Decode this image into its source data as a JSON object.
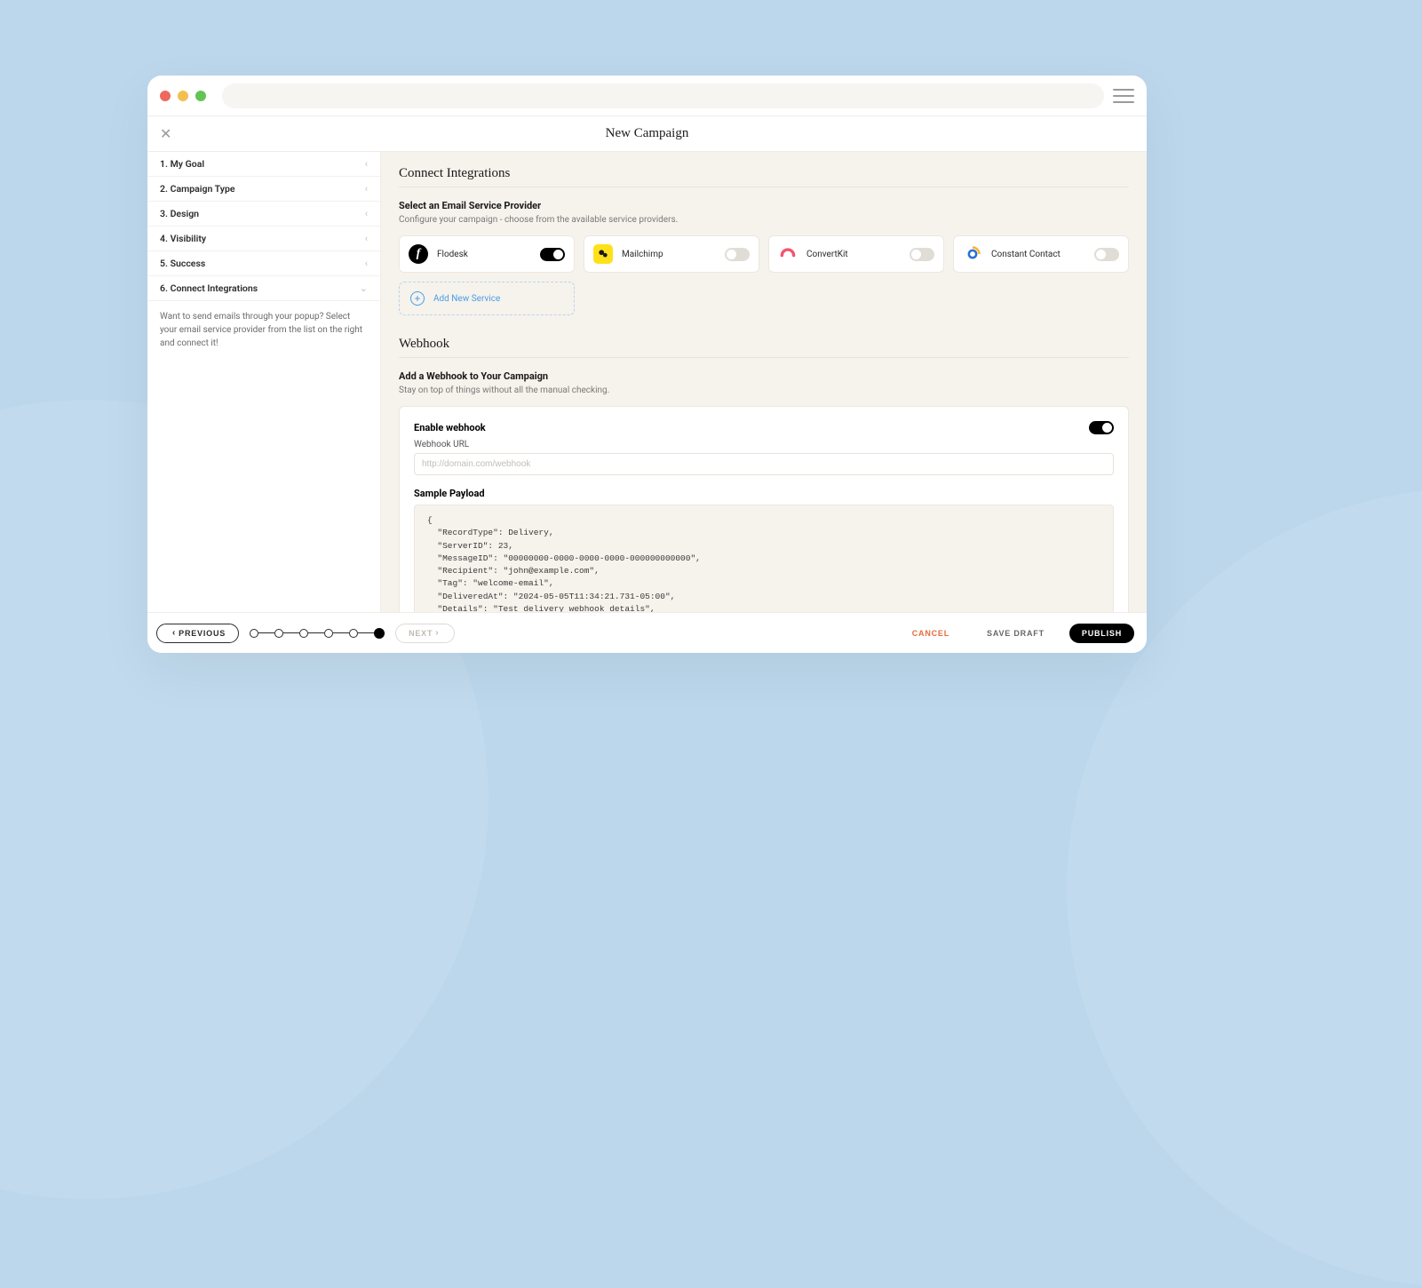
{
  "header": {
    "title": "New Campaign"
  },
  "sidebar": {
    "items": [
      {
        "label": "1. My Goal"
      },
      {
        "label": "2. Campaign Type"
      },
      {
        "label": "3. Design"
      },
      {
        "label": "4. Visibility"
      },
      {
        "label": "5. Success"
      },
      {
        "label": "6. Connect Integrations"
      }
    ],
    "description": "Want to send emails through your popup? Select your email service provider from the list on the right and connect it!"
  },
  "integrations": {
    "section_title": "Connect Integrations",
    "sub_title": "Select an Email Service Provider",
    "sub_desc": "Configure your campaign - choose from the available service providers.",
    "providers": [
      {
        "name": "Flodesk",
        "on": true
      },
      {
        "name": "Mailchimp",
        "on": false
      },
      {
        "name": "ConvertKit",
        "on": false
      },
      {
        "name": "Constant Contact",
        "on": false
      }
    ],
    "add_new": "Add New Service"
  },
  "webhook": {
    "section_title": "Webhook",
    "sub_title": "Add a Webhook to Your Campaign",
    "sub_desc": "Stay on top of things without all the manual checking.",
    "enable_label": "Enable webhook",
    "enabled": true,
    "url_label": "Webhook URL",
    "url_placeholder": "http://domain.com/webhook",
    "sample_label": "Sample Payload",
    "sample": "{\n  \"RecordType\": Delivery,\n  \"ServerID\": 23,\n  \"MessageID\": \"00000000-0000-0000-0000-000000000000\",\n  \"Recipient\": \"john@example.com\",\n  \"Tag\": \"welcome-email\",\n  \"DeliveredAt\": \"2024-05-05T11:34:21.731-05:00\",\n  \"Details\": \"Test delivery webhook details\",\n  \"Metadata\": {\n    \"example\": \"value\",\n    \"example_2\": \"value\"\n  }"
  },
  "footer": {
    "previous": "PREVIOUS",
    "next": "NEXT",
    "cancel": "CANCEL",
    "save_draft": "SAVE DRAFT",
    "publish": "PUBLISH",
    "total_steps": 6,
    "current_step": 6
  }
}
